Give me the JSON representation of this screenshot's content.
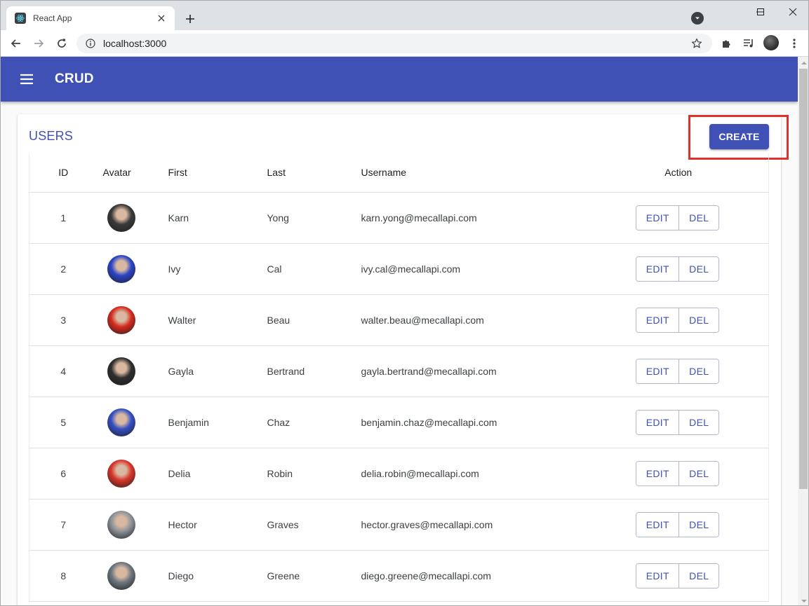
{
  "browser": {
    "tab_title": "React App",
    "url": "localhost:3000"
  },
  "app": {
    "title": "CRUD",
    "section_title": "USERS",
    "create_label": "CREATE",
    "primary_color": "#3f51b5",
    "highlight_color": "#e0322b"
  },
  "table": {
    "headers": [
      "ID",
      "Avatar",
      "First",
      "Last",
      "Username",
      "Action"
    ],
    "edit_label": "EDIT",
    "del_label": "DEL",
    "rows": [
      {
        "id": "1",
        "first": "Karn",
        "last": "Yong",
        "username": "karn.yong@mecallapi.com",
        "avatar": "#3a3a3a"
      },
      {
        "id": "2",
        "first": "Ivy",
        "last": "Cal",
        "username": "ivy.cal@mecallapi.com",
        "avatar": "#2b45c9"
      },
      {
        "id": "3",
        "first": "Walter",
        "last": "Beau",
        "username": "walter.beau@mecallapi.com",
        "avatar": "#d62b1f"
      },
      {
        "id": "4",
        "first": "Gayla",
        "last": "Bertrand",
        "username": "gayla.bertrand@mecallapi.com",
        "avatar": "#2e2e2e"
      },
      {
        "id": "5",
        "first": "Benjamin",
        "last": "Chaz",
        "username": "benjamin.chaz@mecallapi.com",
        "avatar": "#3550c4"
      },
      {
        "id": "6",
        "first": "Delia",
        "last": "Robin",
        "username": "delia.robin@mecallapi.com",
        "avatar": "#d9362a"
      },
      {
        "id": "7",
        "first": "Hector",
        "last": "Graves",
        "username": "hector.graves@mecallapi.com",
        "avatar": "#8d9399"
      },
      {
        "id": "8",
        "first": "Diego",
        "last": "Greene",
        "username": "diego.greene@mecallapi.com",
        "avatar": "#6d7680"
      }
    ]
  }
}
